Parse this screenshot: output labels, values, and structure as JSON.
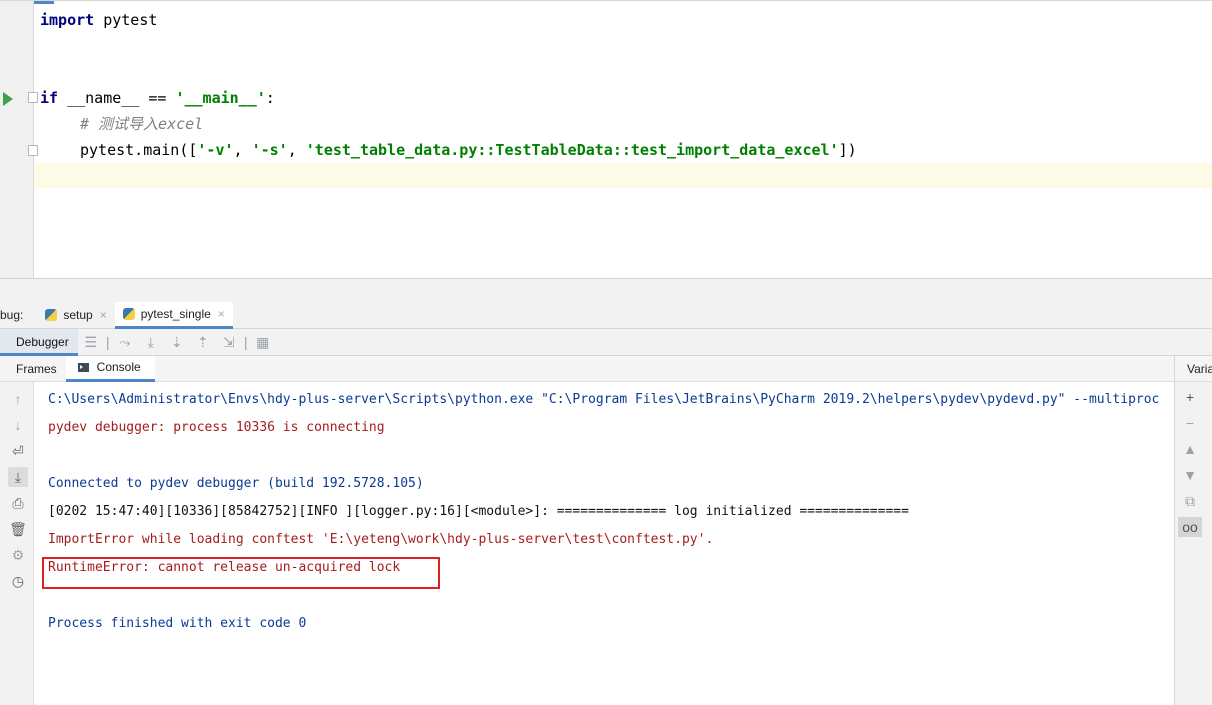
{
  "editor": {
    "code": {
      "line1": {
        "kw": "import",
        "rest": " pytest"
      },
      "line2": {
        "kw": "if",
        "mid": " __name__ == ",
        "str": "'__main__'",
        "end": ":"
      },
      "line3": {
        "comment": "# 测试导入excel"
      },
      "line4": {
        "start": "pytest.main([",
        "s1": "'-v'",
        "sep1": ", ",
        "s2": "'-s'",
        "sep2": ", ",
        "s3": "'test_table_data.py::TestTableData::test_import_data_excel'",
        "end": "])"
      }
    }
  },
  "debug_window": {
    "title": "bug:",
    "tabs": [
      {
        "label": "setup",
        "close": "×"
      },
      {
        "label": "pytest_single",
        "close": "×"
      }
    ],
    "debugger_tab": "Debugger",
    "subtabs": {
      "frames": "Frames",
      "console": "Console"
    },
    "variables_header": "Variables"
  },
  "console": {
    "lines": [
      "C:\\Users\\Administrator\\Envs\\hdy-plus-server\\Scripts\\python.exe \"C:\\Program Files\\JetBrains\\PyCharm 2019.2\\helpers\\pydev\\pydevd.py\" --multiproc",
      "pydev debugger: process 10336 is connecting",
      "Connected to pydev debugger (build 192.5728.105)",
      "[0202 15:47:40][10336][85842752][INFO ][logger.py:16][<module>]: ============== log initialized ==============",
      "ImportError while loading conftest 'E:\\yeteng\\work\\hdy-plus-server\\test\\conftest.py'.",
      "RuntimeError: cannot release un-acquired lock",
      "Process finished with exit code 0"
    ]
  },
  "colors": {
    "accent": "#4a88c7",
    "console_blue": "#0b3a96",
    "console_red": "#a61d1d",
    "error_box": "#e02020",
    "run_green": "#3ca24c"
  }
}
